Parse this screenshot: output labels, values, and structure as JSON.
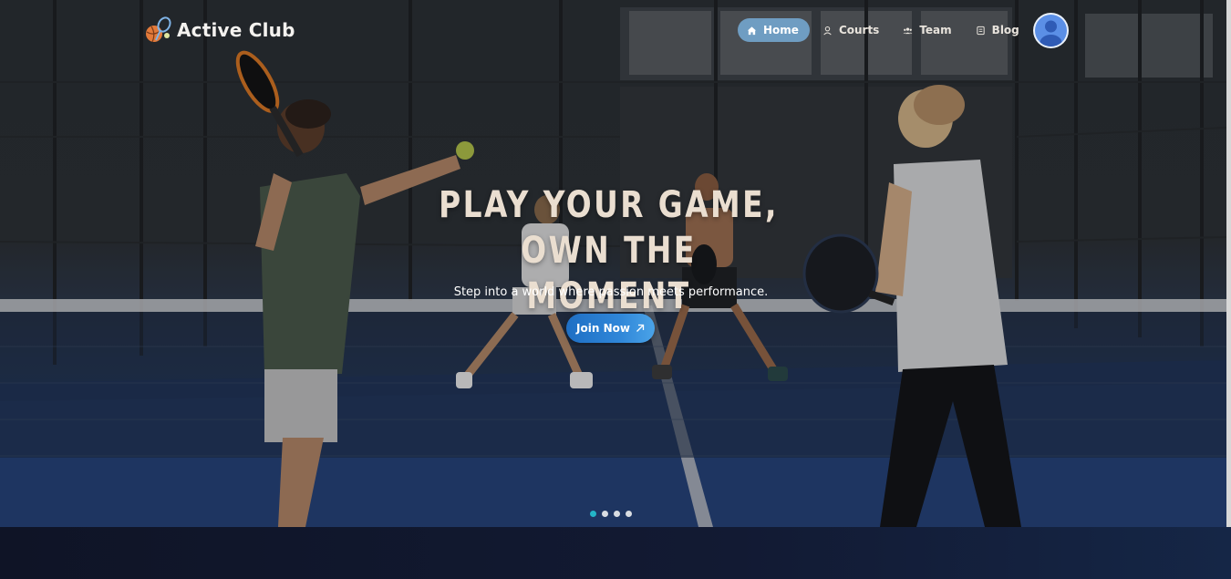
{
  "brand": {
    "name": "Active Club",
    "logo_icon": "sports-balls-icon"
  },
  "nav": {
    "items": [
      {
        "label": "Home",
        "icon": "home-icon",
        "active": true
      },
      {
        "label": "Courts",
        "icon": "user-outline-icon",
        "active": false
      },
      {
        "label": "Team",
        "icon": "group-icon",
        "active": false
      },
      {
        "label": "Blog",
        "icon": "document-icon",
        "active": false
      }
    ],
    "avatar_icon": "user-avatar-icon"
  },
  "hero": {
    "headline_line1": "PLAY YOUR GAME, OWN THE",
    "headline_line2": "MOMENT",
    "subtitle": "Step into a world where passion meets performance.",
    "cta_label": "Join Now",
    "cta_icon": "arrow-up-right-icon"
  },
  "carousel": {
    "slide_count": 4,
    "active_index": 0
  },
  "colors": {
    "accent": "#6f9dc2",
    "cta": "#2f86d8",
    "active_dot": "#24b5c7",
    "headline": "#eaded0"
  }
}
